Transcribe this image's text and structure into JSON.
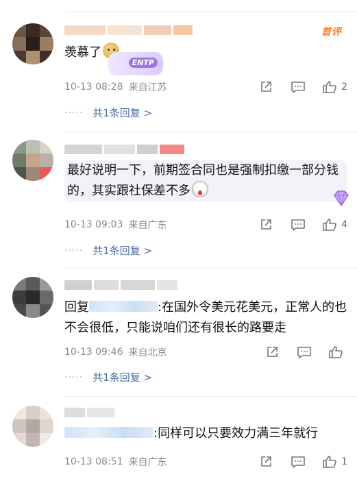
{
  "comments": [
    {
      "text": "羡慕了",
      "badge": "首评",
      "sticker_label": "ENTP",
      "time": "10-13 08:28",
      "location": "来自江苏",
      "likes": "2",
      "replies_label": "共1条回复 >"
    },
    {
      "text": "最好说明一下，前期签合同也是强制扣缴一部分钱的，其实跟社保差不多",
      "time": "10-13 09:03",
      "location": "来自广东",
      "likes": "4",
      "replies_label": "共1条回复 >"
    },
    {
      "reply_prefix": "回复",
      "text": ":在国外令美元花美元，正常人的也不会很低，只能说咱们还有很长的路要走",
      "time": "10-13 09:46",
      "location": "来自北京",
      "likes": "",
      "replies_label": "共1条回复 >"
    },
    {
      "text": ":同样可以只要效力满三年就行",
      "time": "10-13 08:51",
      "location": "来自广东",
      "likes": "1"
    }
  ],
  "replies_dots": "·····",
  "icons": {
    "share": "share-icon",
    "comment": "comment-icon",
    "like": "thumbs-up-icon"
  },
  "colors": {
    "link": "#4a6fa5",
    "meta": "#8a8a8a",
    "badge": "#ff7a1a",
    "bubble": "#f4f1f8"
  }
}
